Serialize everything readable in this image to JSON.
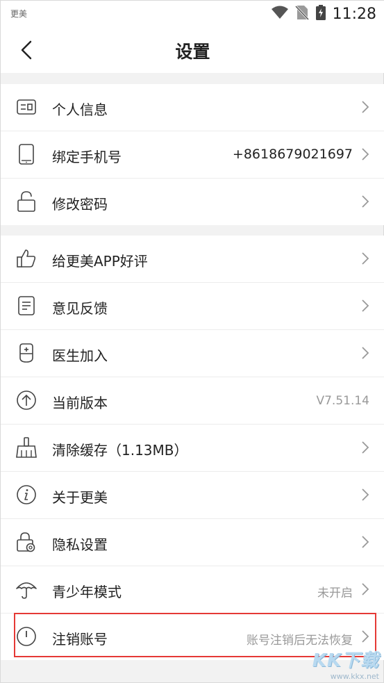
{
  "status_bar": {
    "app_label": "更美",
    "time": "11:28",
    "icons": [
      "wifi-icon",
      "no-sim-icon",
      "battery-charging-icon"
    ]
  },
  "header": {
    "title": "设置",
    "back_icon": "chevron-left-icon"
  },
  "groups": [
    {
      "items": [
        {
          "icon": "id-card-icon",
          "label": "个人信息",
          "value": ""
        },
        {
          "icon": "phone-icon",
          "label": "绑定手机号",
          "value": "+8618679021697"
        },
        {
          "icon": "unlock-icon",
          "label": "修改密码",
          "value": ""
        }
      ]
    },
    {
      "items": [
        {
          "icon": "thumbs-up-icon",
          "label": "给更美APP好评",
          "value": ""
        },
        {
          "icon": "document-icon",
          "label": "意见反馈",
          "value": ""
        },
        {
          "icon": "doctor-icon",
          "label": "医生加入",
          "value": ""
        },
        {
          "icon": "upgrade-icon",
          "label": "当前版本",
          "value": "V7.51.14"
        },
        {
          "icon": "broom-icon",
          "label": "清除缓存（1.13MB）",
          "value": ""
        },
        {
          "icon": "info-icon",
          "label": "关于更美",
          "value": ""
        },
        {
          "icon": "privacy-lock-icon",
          "label": "隐私设置",
          "value": ""
        },
        {
          "icon": "umbrella-icon",
          "label": "青少年模式",
          "value": "未开启"
        },
        {
          "icon": "power-icon",
          "label": "注销账号",
          "value": "账号注销后无法恢复"
        }
      ]
    }
  ],
  "highlight_color": "#e53935",
  "watermark": {
    "brand": "KK下载",
    "url": "www.kkx.net"
  }
}
